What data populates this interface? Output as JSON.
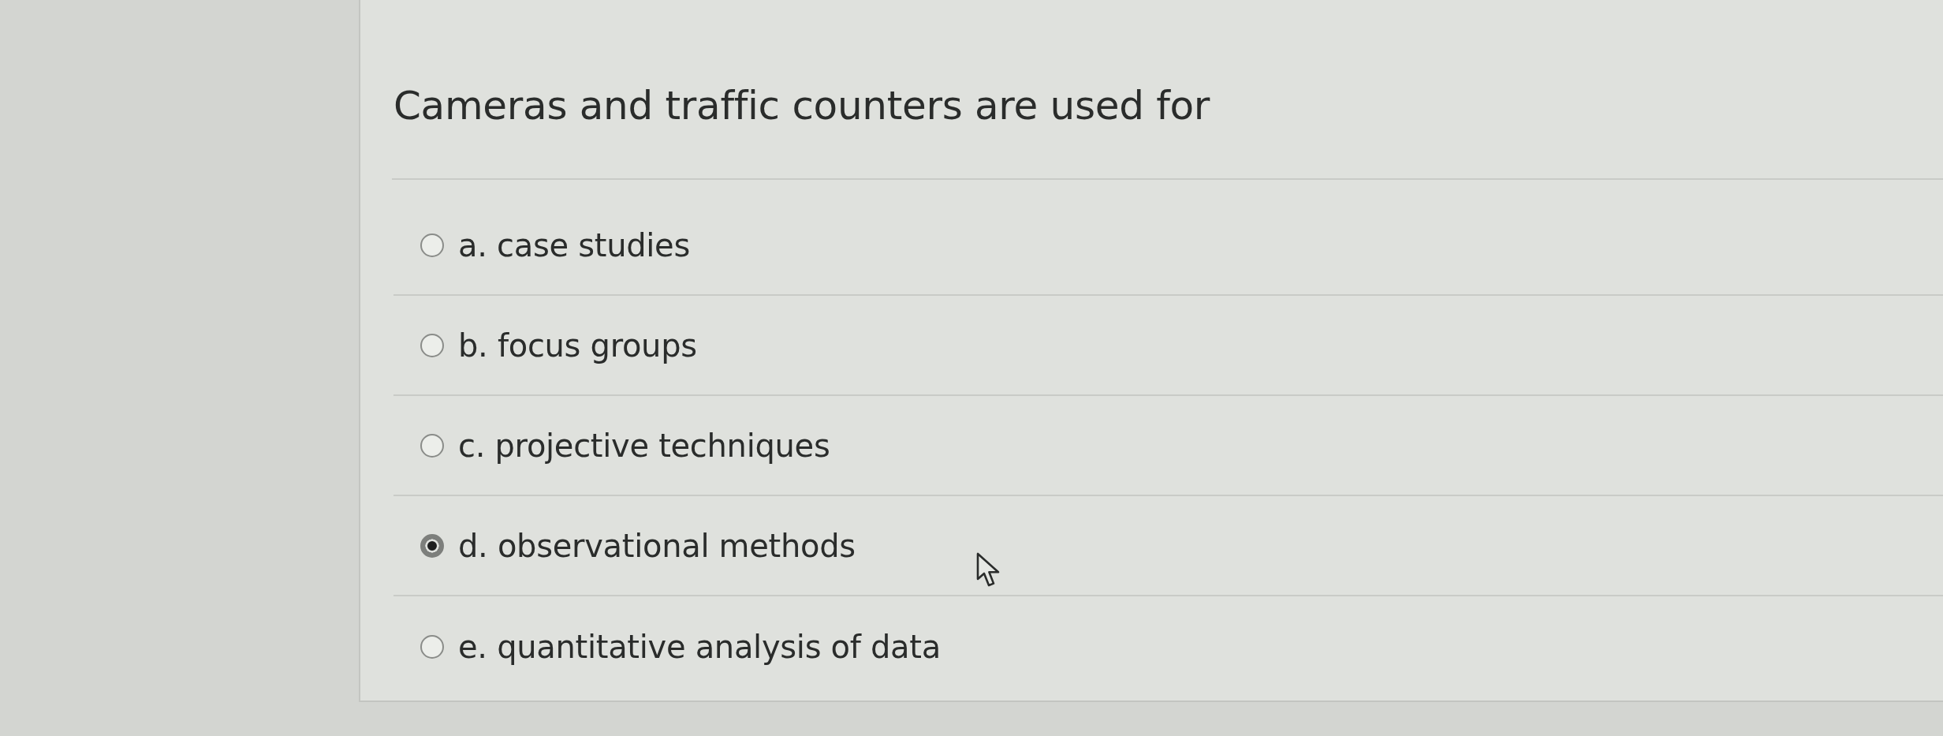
{
  "question": {
    "text": "Cameras and traffic counters are used for"
  },
  "options": [
    {
      "label": "a. case studies",
      "selected": false
    },
    {
      "label": "b. focus groups",
      "selected": false
    },
    {
      "label": "c. projective techniques",
      "selected": false
    },
    {
      "label": "d. observational methods",
      "selected": true
    },
    {
      "label": "e. quantitative analysis of data",
      "selected": false
    }
  ]
}
